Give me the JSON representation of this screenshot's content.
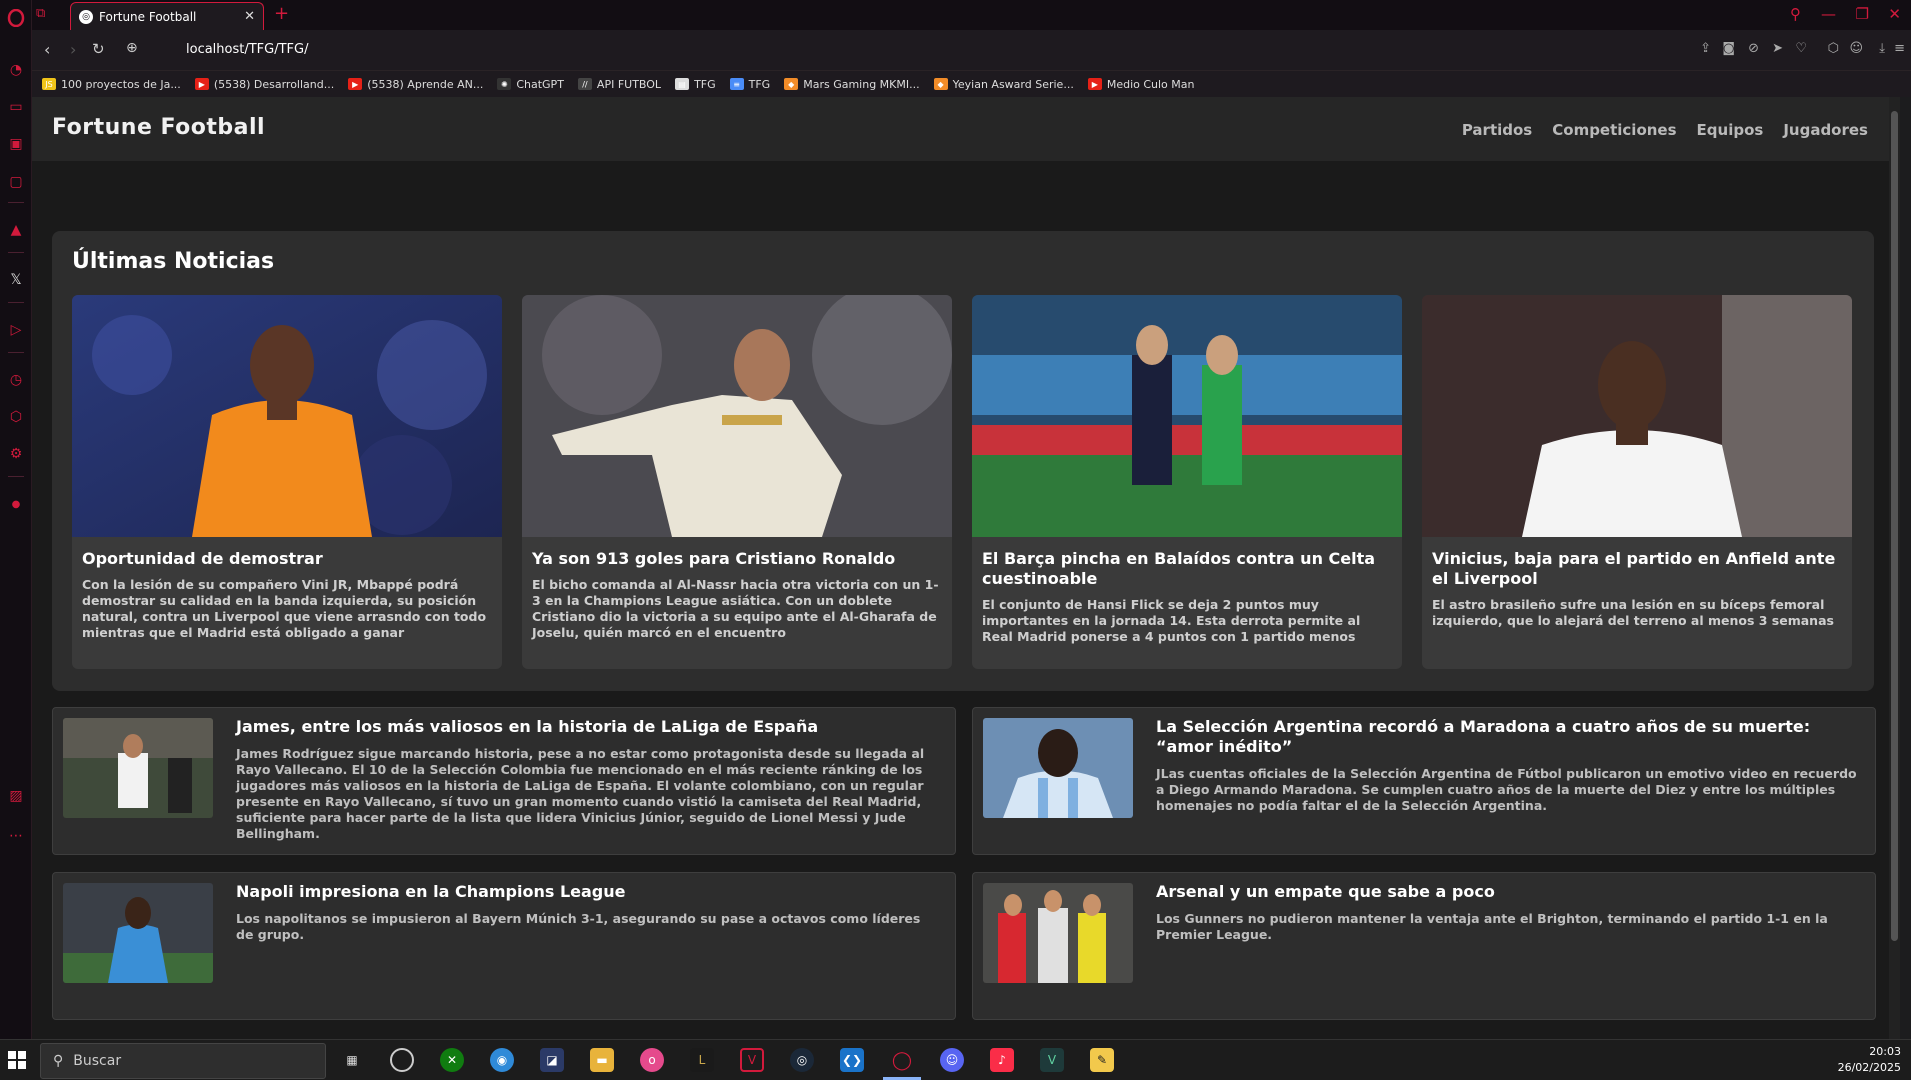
{
  "browser": {
    "tab_title": "Fortune Football",
    "url": "localhost/TFG/TFG/",
    "bookmarks": [
      {
        "label": "100 proyectos de Ja...",
        "color": "#f0c419",
        "icon": "JS"
      },
      {
        "label": "(5538) Desarrolland...",
        "color": "#e62117",
        "icon": "▶"
      },
      {
        "label": "(5538) Aprende AN...",
        "color": "#e62117",
        "icon": "▶"
      },
      {
        "label": "ChatGPT",
        "color": "#333333",
        "icon": "✺"
      },
      {
        "label": "API FUTBOL",
        "color": "#444444",
        "icon": "//"
      },
      {
        "label": "TFG",
        "color": "#dddddd",
        "icon": "▤"
      },
      {
        "label": "TFG",
        "color": "#4a8cf7",
        "icon": "≡"
      },
      {
        "label": "Mars Gaming MKMI...",
        "color": "#f28c28",
        "icon": "◆"
      },
      {
        "label": "Yeyian Asward Serie...",
        "color": "#f28c28",
        "icon": "◆"
      },
      {
        "label": "Medio Culo Man",
        "color": "#e62117",
        "icon": "▶"
      }
    ]
  },
  "site": {
    "logo": "Fortune Football",
    "nav": [
      "Partidos",
      "Competiciones",
      "Equipos",
      "Jugadores"
    ],
    "section_title": "Últimas Noticias",
    "featured": [
      {
        "title": "Oportunidad de demostrar",
        "desc": "Con la lesión de su compañero Vini JR, Mbappé podrá demostrar su calidad en la banda izquierda, su posición natural, contra un Liverpool que viene arrasndo con todo mientras que el Madrid está obligado a ganar"
      },
      {
        "title": "Ya son 913 goles para Cristiano Ronaldo",
        "desc": "El bicho comanda al Al-Nassr hacia otra victoria con un 1-3 en la Champions League asiática. Con un doblete Cristiano dio la victoria a su equipo ante el Al-Gharafa de Joselu, quién marcó en el encuentro"
      },
      {
        "title": "El Barça pincha en Balaídos contra un Celta cuestinoable",
        "desc": "El conjunto de Hansi Flick se deja 2 puntos muy importantes en la jornada 14. Esta derrota permite al Real Madrid ponerse a 4 puntos con 1 partido menos"
      },
      {
        "title": "Vinicius, baja para el partido en Anfield ante el Liverpool",
        "desc": "El astro brasileño sufre una lesión en su bíceps femoral izquierdo, que lo alejará del terreno al menos 3 semanas"
      }
    ],
    "list": [
      {
        "title": "James, entre los más valiosos en la historia de LaLiga de España",
        "desc": "James Rodríguez sigue marcando historia, pese a no estar como protagonista desde su llegada al Rayo Vallecano. El 10 de la Selección Colombia fue mencionado en el más reciente ránking de los jugadores más valiosos en la historia de LaLiga de España. El volante colombiano, con un regular presente en Rayo Vallecano, sí tuvo un gran momento cuando vistió la camiseta del Real Madrid, suficiente para hacer parte de la lista que lidera Vinicius Júnior, seguido de Lionel Messi y Jude Bellingham."
      },
      {
        "title": "La Selección Argentina recordó a Maradona a cuatro años de su muerte: “amor inédito”",
        "desc": "JLas cuentas oficiales de la Selección Argentina de Fútbol publicaron un emotivo video en recuerdo a Diego Armando Maradona. Se cumplen cuatro años de la muerte del Diez y entre los múltiples homenajes no podía faltar el de la Selección Argentina."
      },
      {
        "title": "Napoli impresiona en la Champions League",
        "desc": "Los napolitanos se impusieron al Bayern Múnich 3-1, asegurando su pase a octavos como líderes de grupo."
      },
      {
        "title": "Arsenal y un empate que sabe a poco",
        "desc": "Los Gunners no pudieron mantener la ventaja ante el Brighton, terminando el partido 1-1 en la Premier League."
      }
    ]
  },
  "taskbar": {
    "search_placeholder": "Buscar",
    "time": "20:03",
    "date": "26/02/2025"
  },
  "colors": {
    "accent": "#d21a3c",
    "page_bg": "#1a1a1a",
    "card_bg": "#3a3a3a"
  }
}
